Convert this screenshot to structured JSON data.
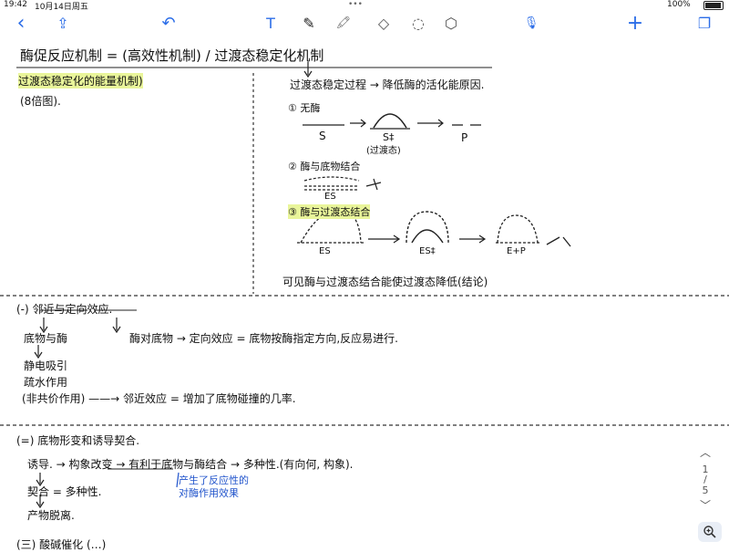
{
  "status": {
    "time": "19:42",
    "date": "10月14日周五",
    "battery": "100%"
  },
  "toolbar": {
    "back": "‹",
    "share": "⇪",
    "undo": "↶",
    "text": "T",
    "pen": "✎",
    "highlighter": "🖍",
    "eraser": "◇",
    "lasso": "◌",
    "shape": "⬡",
    "mic": "🎙",
    "add": "+",
    "pages": "❐"
  },
  "notes": {
    "title": "酶促反应机制 = (高效性机制) / 过渡态稳定化机制",
    "left_title": "过渡态稳定化的能量机制)",
    "left_sub": "(8倍图).",
    "right_1": "过渡态稳定过程 → 降低酶的活化能原因.",
    "right_2": "① 无酶",
    "lbl_S": "S",
    "lbl_Sstar": "S‡",
    "lbl_sub1": "(过渡态)",
    "lbl_P": "P",
    "right_3": "② 酶与底物结合",
    "lbl_ES1": "ES",
    "right_4": "③ 酶与过渡态结合",
    "lbl_ES": "ES",
    "lbl_ESstar": "ES‡",
    "lbl_EP": "E+P",
    "right_5": "可见酶与过渡态结合能使过渡态降低(结论)",
    "s2_title": "(-) 邻近与定向效应.",
    "s2_l1": "底物与酶",
    "s2_l2": "酶对底物 → 定向效应 = 底物按酶指定方向,反应易进行.",
    "s2_l3": "静电吸引",
    "s2_l4": "疏水作用",
    "s2_l5": "(非共价作用) ——→ 邻近效应 = 增加了底物碰撞的几率.",
    "s3_title": "(=) 底物形变和诱导契合.",
    "s3_l1": "诱导. → 构象改变 → 有利于底物与酶结合 → 多种性.(有向何, 构象).",
    "s3_note1": "产生了反应性的",
    "s3_note2": "对酶作用效果",
    "s3_l2": "契合 = 多种性.",
    "s3_l3": "产物脱离.",
    "s4_title": "(三) 酸碱催化 (…)"
  },
  "pager": {
    "current": "1",
    "total": "5"
  }
}
